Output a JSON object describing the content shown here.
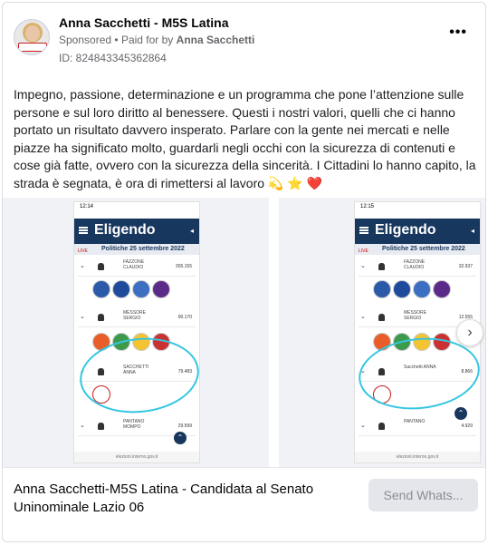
{
  "post": {
    "page_name": "Anna Sacchetti - M5S Latina",
    "sponsored": "Sponsored",
    "paid_for_prefix": "Paid for by",
    "paid_for_name": "Anna Sacchetti",
    "ad_id": "ID: 824843345362864",
    "more_label": "•••",
    "body_text": "Impegno, passione, determinazione e un programma che pone l’attenzione sulle persone e sul loro diritto al benessere. Questi i nostri valori, quelli che ci hanno portato un risultato davvero insperato. Parlare con la gente nei mercati e nelle piazze ha significato molto, guardarli negli occhi con la sicurezza di contenuti e cose già fatte, ovvero con la sicurezza della sincerità. I Cittadini lo hanno capito, la strada è segnata, è ora di rimettersi al lavoro 💫 ⭐ ❤️"
  },
  "carousel": {
    "slides": [
      {
        "time": "12:14",
        "app": "Eligendo",
        "subtitle": "Politiche 25 settembre 2022",
        "live": "LIVE",
        "rows": [
          {
            "name": "FAZZONE CLAUDIO",
            "votes": "265.155"
          },
          {
            "name": "MESSORE SERGIO",
            "votes": "90.170"
          },
          {
            "name": "SACCHETTI ANNA",
            "votes": "79.483"
          },
          {
            "name": "PANTANO MOMPO",
            "votes": "29.599"
          }
        ],
        "bottom": "elezioni.interno.gov.it"
      },
      {
        "time": "12:15",
        "app": "Eligendo",
        "subtitle": "Politiche 25 settembre 2022",
        "live": "LIVE",
        "rows": [
          {
            "name": "FAZZONE CLAUDIO",
            "votes": "32.937"
          },
          {
            "name": "MESSORE SERGIO",
            "votes": "12.555"
          },
          {
            "name": "Sacchetti ANNA",
            "votes": "8.866"
          },
          {
            "name": "PANTANO",
            "votes": "4.929"
          }
        ],
        "bottom": "elezioni.interno.gov.it"
      }
    ],
    "next_icon": "chevron-right-icon"
  },
  "footer": {
    "title": "Anna Sacchetti-M5S Latina - Candidata al Senato Uninominale Lazio 06",
    "cta_label": "Send Whats..."
  }
}
